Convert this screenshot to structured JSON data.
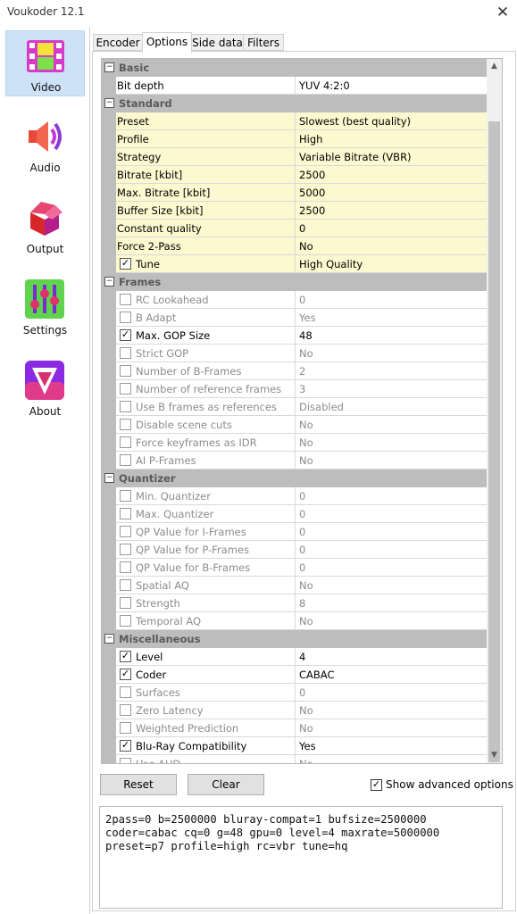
{
  "window": {
    "title": "Voukoder 12.1",
    "close_glyph": "✕"
  },
  "nav": [
    {
      "label": "Video",
      "icon": "video-film-icon",
      "active": true
    },
    {
      "label": "Audio",
      "icon": "speaker-icon",
      "active": false
    },
    {
      "label": "Output",
      "icon": "package-box-icon",
      "active": false
    },
    {
      "label": "Settings",
      "icon": "sliders-icon",
      "active": false
    },
    {
      "label": "About",
      "icon": "voukoder-logo-icon",
      "active": false
    }
  ],
  "tabs": [
    "Encoder",
    "Options",
    "Side data",
    "Filters"
  ],
  "active_tab": "Options",
  "grid": {
    "rows": [
      {
        "type": "cat",
        "name": "Basic"
      },
      {
        "type": "prop",
        "name": "Bit depth",
        "value": "YUV 4:2:0"
      },
      {
        "type": "cat",
        "name": "Standard"
      },
      {
        "type": "prop",
        "name": "Preset",
        "value": "Slowest (best quality)",
        "yellow": true
      },
      {
        "type": "prop",
        "name": "Profile",
        "value": "High",
        "yellow": true
      },
      {
        "type": "prop",
        "name": "Strategy",
        "value": "Variable Bitrate (VBR)",
        "yellow": true
      },
      {
        "type": "prop",
        "name": "Bitrate [kbit]",
        "value": "2500",
        "yellow": true
      },
      {
        "type": "prop",
        "name": "Max. Bitrate [kbit]",
        "value": "5000",
        "yellow": true
      },
      {
        "type": "prop",
        "name": "Buffer Size [kbit]",
        "value": "2500",
        "yellow": true
      },
      {
        "type": "prop",
        "name": "Constant quality",
        "value": "0",
        "yellow": true
      },
      {
        "type": "prop",
        "name": "Force 2-Pass",
        "value": "No",
        "yellow": true
      },
      {
        "type": "prop",
        "name": "Tune",
        "value": "High Quality",
        "yellow": true,
        "checkbox": true,
        "checked": true
      },
      {
        "type": "cat",
        "name": "Frames"
      },
      {
        "type": "prop",
        "name": "RC Lookahead",
        "value": "0",
        "checkbox": true,
        "checked": false
      },
      {
        "type": "prop",
        "name": "B Adapt",
        "value": "Yes",
        "checkbox": true,
        "checked": false
      },
      {
        "type": "prop",
        "name": "Max. GOP Size",
        "value": "48",
        "checkbox": true,
        "checked": true
      },
      {
        "type": "prop",
        "name": "Strict GOP",
        "value": "No",
        "checkbox": true,
        "checked": false
      },
      {
        "type": "prop",
        "name": "Number of B-Frames",
        "value": "2",
        "checkbox": true,
        "checked": false
      },
      {
        "type": "prop",
        "name": "Number of reference frames",
        "value": "3",
        "checkbox": true,
        "checked": false
      },
      {
        "type": "prop",
        "name": "Use B frames as references",
        "value": "Disabled",
        "checkbox": true,
        "checked": false
      },
      {
        "type": "prop",
        "name": "Disable scene cuts",
        "value": "No",
        "checkbox": true,
        "checked": false
      },
      {
        "type": "prop",
        "name": "Force keyframes as IDR",
        "value": "No",
        "checkbox": true,
        "checked": false
      },
      {
        "type": "prop",
        "name": "AI P-Frames",
        "value": "No",
        "checkbox": true,
        "checked": false
      },
      {
        "type": "cat",
        "name": "Quantizer"
      },
      {
        "type": "prop",
        "name": "Min. Quantizer",
        "value": "0",
        "checkbox": true,
        "checked": false
      },
      {
        "type": "prop",
        "name": "Max. Quantizer",
        "value": "0",
        "checkbox": true,
        "checked": false
      },
      {
        "type": "prop",
        "name": "QP Value for I-Frames",
        "value": "0",
        "checkbox": true,
        "checked": false
      },
      {
        "type": "prop",
        "name": "QP Value for P-Frames",
        "value": "0",
        "checkbox": true,
        "checked": false
      },
      {
        "type": "prop",
        "name": "QP Value for B-Frames",
        "value": "0",
        "checkbox": true,
        "checked": false
      },
      {
        "type": "prop",
        "name": "Spatial AQ",
        "value": "No",
        "checkbox": true,
        "checked": false
      },
      {
        "type": "prop",
        "name": "Strength",
        "value": "8",
        "checkbox": true,
        "checked": false
      },
      {
        "type": "prop",
        "name": "Temporal AQ",
        "value": "No",
        "checkbox": true,
        "checked": false
      },
      {
        "type": "cat",
        "name": "Miscellaneous"
      },
      {
        "type": "prop",
        "name": "Level",
        "value": "4",
        "checkbox": true,
        "checked": true
      },
      {
        "type": "prop",
        "name": "Coder",
        "value": "CABAC",
        "checkbox": true,
        "checked": true
      },
      {
        "type": "prop",
        "name": "Surfaces",
        "value": "0",
        "checkbox": true,
        "checked": false
      },
      {
        "type": "prop",
        "name": "Zero Latency",
        "value": "No",
        "checkbox": true,
        "checked": false
      },
      {
        "type": "prop",
        "name": "Weighted Prediction",
        "value": "No",
        "checkbox": true,
        "checked": false
      },
      {
        "type": "prop",
        "name": "Blu-Ray Compatibility",
        "value": "Yes",
        "checkbox": true,
        "checked": true
      },
      {
        "type": "prop",
        "name": "Use AUD",
        "value": "No",
        "checkbox": true,
        "checked": false
      }
    ]
  },
  "buttons": {
    "reset": "Reset",
    "clear": "Clear"
  },
  "show_advanced": {
    "label": "Show advanced options",
    "checked": true
  },
  "command_line": "2pass=0 b=2500000 bluray-compat=1 bufsize=2500000\ncoder=cabac cq=0 g=48 gpu=0 level=4 maxrate=5000000\npreset=p7 profile=high rc=vbr tune=hq",
  "colors": {
    "category_bg": "#bdbdbd",
    "highlight_bg": "#fcf8d0",
    "nav_active_bg": "#cde2f6",
    "disabled_text": "#8c8c8c"
  }
}
